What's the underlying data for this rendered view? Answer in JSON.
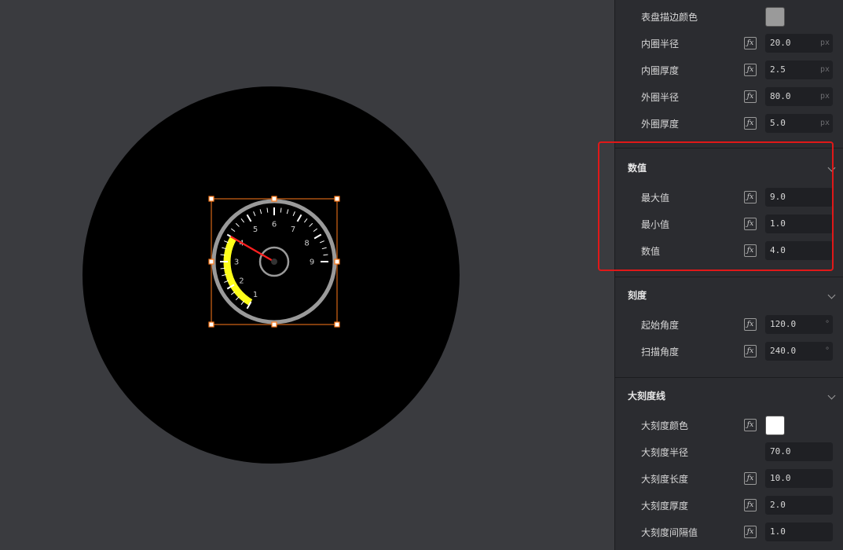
{
  "gauge": {
    "value": 4.0,
    "min": 1.0,
    "max": 9.0,
    "start_angle": 120.0,
    "sweep_angle": 240.0,
    "tick_labels": [
      "1",
      "2",
      "3",
      "4",
      "5",
      "6",
      "7",
      "8",
      "9"
    ],
    "colors": {
      "progress": "#ffff1a",
      "needle": "#ff2020",
      "rim": "#9a9a9a",
      "ticks": "#ffffff",
      "labels": "#cccccc",
      "canvas_bg": "#000000",
      "selection": "#ff7a1a"
    }
  },
  "panel": {
    "dial_props": {
      "border_color_label": "表盘描边颜色",
      "border_color": "#9a9a9a",
      "inner_radius_label": "内圈半径",
      "inner_radius": "20.0",
      "inner_radius_unit": "px",
      "inner_thickness_label": "内圈厚度",
      "inner_thickness": "2.5",
      "inner_thickness_unit": "px",
      "outer_radius_label": "外圈半径",
      "outer_radius": "80.0",
      "outer_radius_unit": "px",
      "outer_thickness_label": "外圈厚度",
      "outer_thickness": "5.0",
      "outer_thickness_unit": "px"
    },
    "value_section": {
      "title": "数值",
      "max_label": "最大值",
      "max": "9.0",
      "min_label": "最小值",
      "min": "1.0",
      "value_label": "数值",
      "value": "4.0"
    },
    "scale_section": {
      "title": "刻度",
      "start_angle_label": "起始角度",
      "start_angle": "120.0",
      "start_angle_unit": "°",
      "sweep_angle_label": "扫描角度",
      "sweep_angle": "240.0",
      "sweep_angle_unit": "°"
    },
    "major_tick_section": {
      "title": "大刻度线",
      "color_label": "大刻度颜色",
      "color": "#ffffff",
      "radius_label": "大刻度半径",
      "radius": "70.0",
      "length_label": "大刻度长度",
      "length": "10.0",
      "thickness_label": "大刻度厚度",
      "thickness": "2.0",
      "interval_label": "大刻度间隔值",
      "interval": "1.0"
    },
    "fx_icon": "ƒx"
  }
}
